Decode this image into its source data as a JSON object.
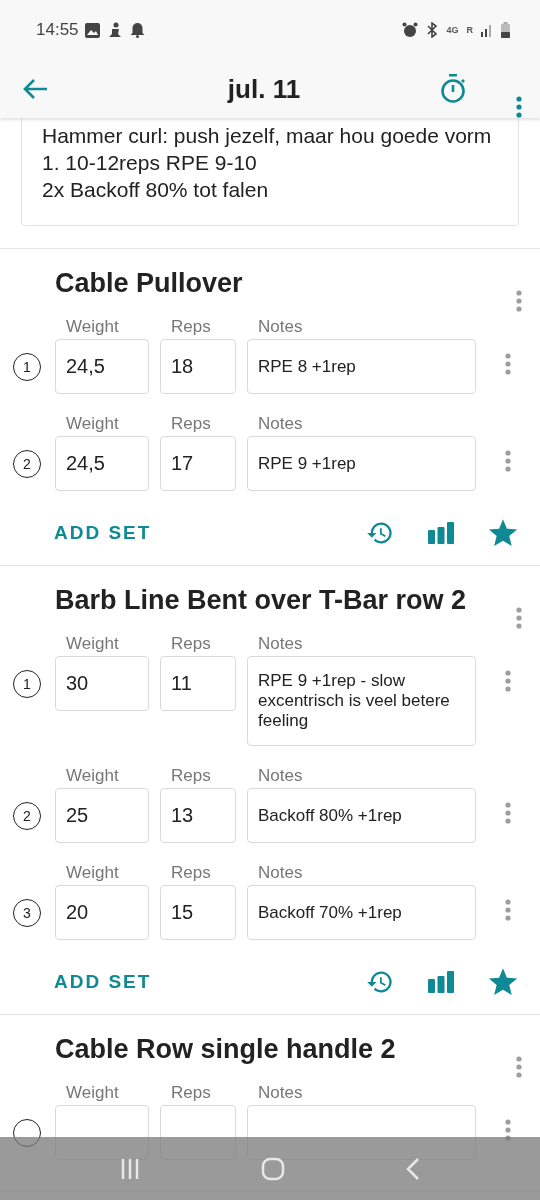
{
  "status_bar": {
    "time": "14:55",
    "network": "4G",
    "roaming": "R"
  },
  "app_bar": {
    "title": "jul. 11"
  },
  "note": {
    "lines": [
      "Hammer curl: push jezelf, maar hou goede vorm",
      "1. 10-12reps RPE 9-10",
      "2x Backoff 80% tot falen"
    ]
  },
  "exercises": [
    {
      "name": "Cable Pullover",
      "add_set": "ADD SET",
      "sets": [
        {
          "number": "1",
          "weight_label": "Weight",
          "reps_label": "Reps",
          "notes_label": "Notes",
          "weight": "24,5",
          "reps": "18",
          "notes": "RPE 8 +1rep"
        },
        {
          "number": "2",
          "weight_label": "Weight",
          "reps_label": "Reps",
          "notes_label": "Notes",
          "weight": "24,5",
          "reps": "17",
          "notes": "RPE 9 +1rep"
        }
      ]
    },
    {
      "name": "Barb Line Bent over T-Bar row 2",
      "add_set": "ADD SET",
      "sets": [
        {
          "number": "1",
          "weight_label": "Weight",
          "reps_label": "Reps",
          "notes_label": "Notes",
          "weight": "30",
          "reps": "11",
          "notes": "RPE 9 +1rep - slow excentrisch is veel betere feeling"
        },
        {
          "number": "2",
          "weight_label": "Weight",
          "reps_label": "Reps",
          "notes_label": "Notes",
          "weight": "25",
          "reps": "13",
          "notes": "Backoff 80% +1rep"
        },
        {
          "number": "3",
          "weight_label": "Weight",
          "reps_label": "Reps",
          "notes_label": "Notes",
          "weight": "20",
          "reps": "15",
          "notes": "Backoff 70% +1rep"
        }
      ]
    },
    {
      "name": "Cable Row single handle 2",
      "sets": [
        {
          "weight_label": "Weight",
          "reps_label": "Reps",
          "notes_label": "Notes"
        }
      ]
    }
  ]
}
